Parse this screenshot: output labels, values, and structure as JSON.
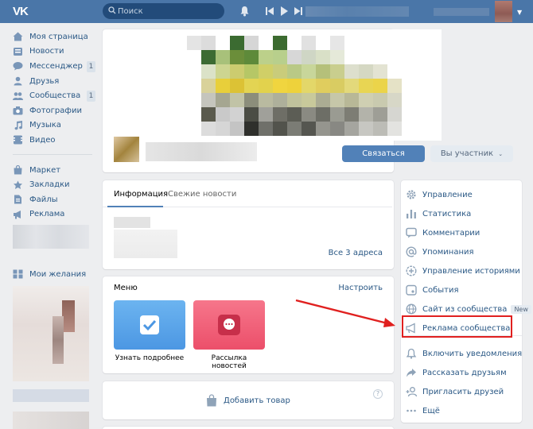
{
  "header": {
    "logo": "VK",
    "search_placeholder": "Поиск"
  },
  "sidebar": {
    "items": [
      {
        "label": "Моя страница",
        "icon": "home-icon"
      },
      {
        "label": "Новости",
        "icon": "news-icon"
      },
      {
        "label": "Мессенджер",
        "icon": "messenger-icon",
        "count": "1"
      },
      {
        "label": "Друзья",
        "icon": "friends-icon"
      },
      {
        "label": "Сообщества",
        "icon": "communities-icon",
        "count": "1"
      },
      {
        "label": "Фотографии",
        "icon": "camera-icon"
      },
      {
        "label": "Музыка",
        "icon": "music-icon"
      },
      {
        "label": "Видео",
        "icon": "video-icon"
      }
    ],
    "items2": [
      {
        "label": "Маркет",
        "icon": "market-icon"
      },
      {
        "label": "Закладки",
        "icon": "bookmark-icon"
      },
      {
        "label": "Файлы",
        "icon": "files-icon"
      },
      {
        "label": "Реклама",
        "icon": "ads-icon"
      }
    ],
    "wishlist": {
      "label": "Мои желания",
      "icon": "wishlist-icon"
    }
  },
  "cover": {
    "contact_button": "Связаться",
    "member_button": "Вы участник"
  },
  "info": {
    "tab_info": "Информация",
    "tab_news": "Свежие новости",
    "all_addresses": "Все 3 адреса"
  },
  "menu": {
    "title": "Меню",
    "configure": "Настроить",
    "tiles": [
      {
        "label": "Узнать подробнее",
        "color": "#5ea6e8"
      },
      {
        "label": "Рассылка новостей",
        "color": "#f0617a"
      }
    ]
  },
  "market": {
    "add_product": "Добавить товар",
    "help": "?"
  },
  "right_menu": [
    {
      "label": "Управление",
      "icon": "gear-icon"
    },
    {
      "label": "Статистика",
      "icon": "stats-icon"
    },
    {
      "label": "Комментарии",
      "icon": "comments-icon"
    },
    {
      "label": "Упоминания",
      "icon": "mention-icon"
    },
    {
      "label": "Управление историями",
      "icon": "stories-icon"
    },
    {
      "label": "События",
      "icon": "events-icon"
    },
    {
      "label": "Сайт из сообщества",
      "icon": "globe-icon",
      "badge": "New"
    },
    {
      "label": "Реклама сообщества",
      "icon": "megaphone-icon",
      "highlight": true
    },
    {
      "label": "Включить уведомления",
      "icon": "bell-icon"
    },
    {
      "label": "Рассказать друзьям",
      "icon": "share-icon"
    },
    {
      "label": "Пригласить друзей",
      "icon": "invite-icon"
    },
    {
      "label": "Ещё",
      "icon": "more-icon"
    }
  ],
  "colors": {
    "header": "#4a76a8",
    "accent": "#5181b8",
    "link": "#2a5885",
    "annotation": "#e0201f"
  }
}
